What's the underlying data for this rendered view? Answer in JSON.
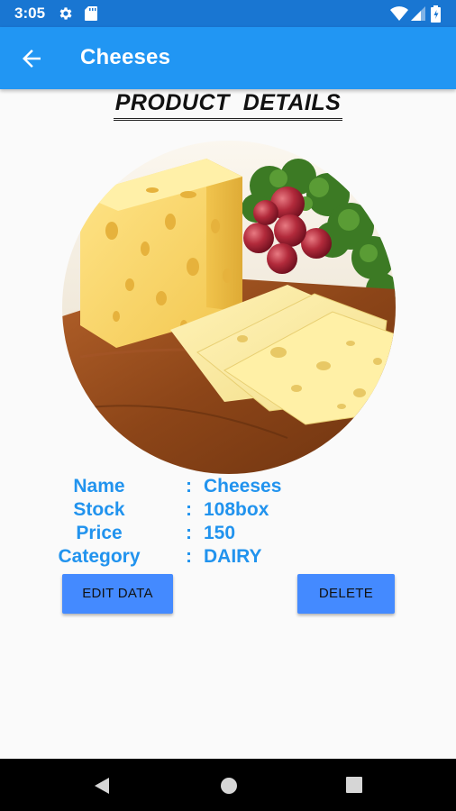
{
  "status_bar": {
    "time": "3:05",
    "icons": [
      "settings-icon",
      "sd-card-icon",
      "wifi-icon",
      "signal-icon",
      "battery-icon"
    ]
  },
  "app_bar": {
    "title": "Cheeses",
    "back_icon": "arrow-back-icon",
    "color": "#2196f3"
  },
  "page": {
    "heading": "PRODUCT  DETAILS"
  },
  "product": {
    "image": "cheese-photo",
    "fields": [
      {
        "label": "Name",
        "value": "Cheeses"
      },
      {
        "label": "Stock",
        "value": "108box"
      },
      {
        "label": "Price",
        "value": "150"
      },
      {
        "label": "Category",
        "value": "DAIRY"
      }
    ],
    "separator": ":"
  },
  "actions": {
    "edit_label": "EDIT DATA",
    "delete_label": "DELETE",
    "button_color": "#448aff"
  },
  "nav_bar": {
    "icons": [
      "nav-back-icon",
      "nav-home-icon",
      "nav-recents-icon"
    ]
  },
  "colors": {
    "status_bar": "#1976d2",
    "detail_text": "#2193ee"
  }
}
